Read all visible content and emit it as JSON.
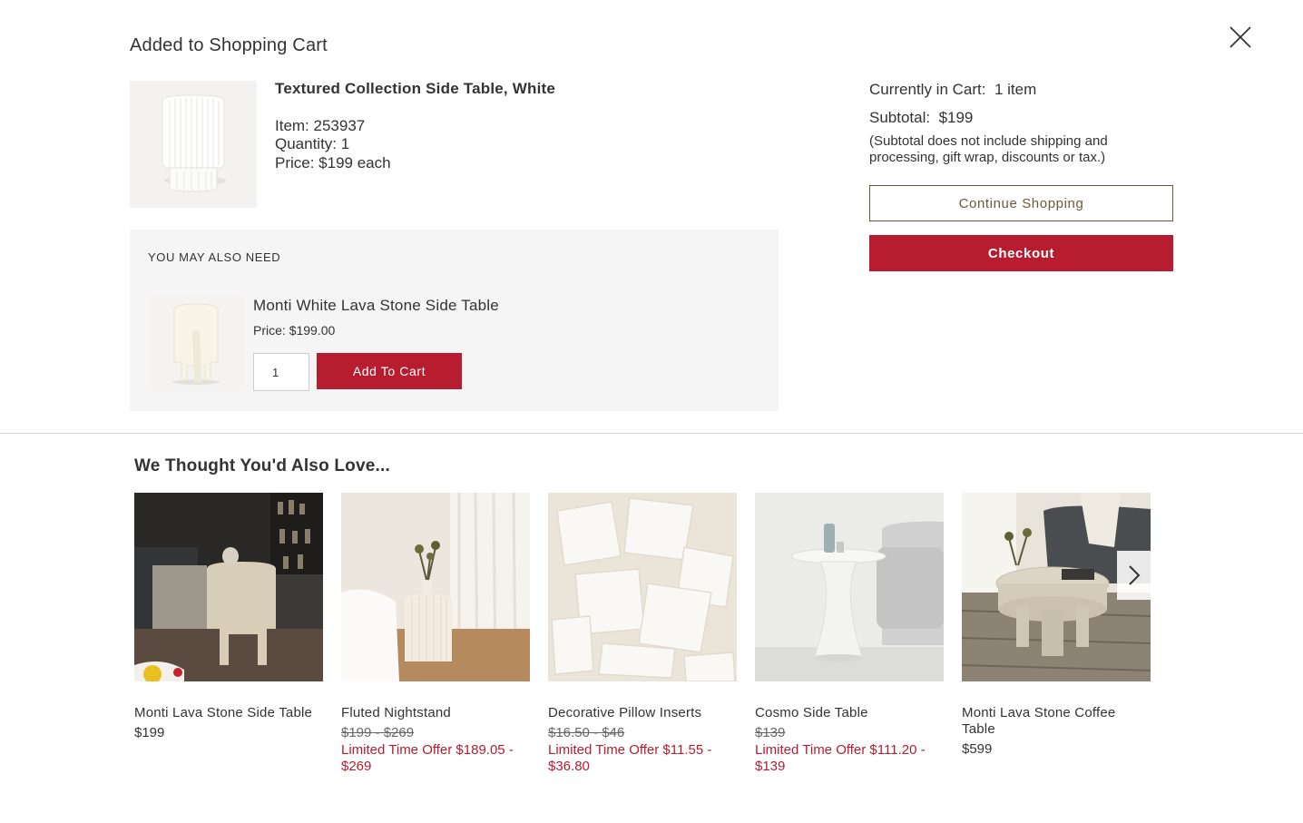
{
  "modal": {
    "title": "Added to Shopping Cart"
  },
  "added_item": {
    "name": "Textured Collection Side Table, White",
    "item": "Item: 253937",
    "quantity": "Quantity: 1",
    "price": "Price: $199 each"
  },
  "upsell": {
    "heading": "YOU MAY ALSO NEED",
    "name": "Monti White Lava Stone Side Table",
    "price_label": "Price: ",
    "price_value": "$199.00",
    "qty_value": "1",
    "add_label": "Add To Cart"
  },
  "cart": {
    "count_label": "Currently in Cart:",
    "count_value": "1 item",
    "subtotal_label": "Subtotal:",
    "subtotal_value": "$199",
    "note": "(Subtotal does not include shipping and processing, gift wrap, discounts or tax.)",
    "continue_label": "Continue Shopping",
    "checkout_label": "Checkout"
  },
  "recommendations": {
    "title": "We Thought You'd Also Love...",
    "items": [
      {
        "name": "Monti Lava Stone Side Table",
        "price": "$199"
      },
      {
        "name": "Fluted Nightstand",
        "was": "$199 - $269",
        "offer": "Limited Time Offer  $189.05 - $269"
      },
      {
        "name": "Decorative Pillow Inserts",
        "was": "$16.50 - $46",
        "offer": "Limited Time Offer  $11.55 - $36.80"
      },
      {
        "name": "Cosmo Side Table",
        "was": "$139",
        "offer": "Limited Time Offer  $111.20 - $139"
      },
      {
        "name": "Monti Lava Stone Coffee Table",
        "price": "$599"
      }
    ]
  },
  "colors": {
    "brand_red": "#b71c2f",
    "continue_border": "#6b5a3a"
  },
  "icons": {
    "close": "close-icon",
    "next": "chevron-right-icon"
  }
}
